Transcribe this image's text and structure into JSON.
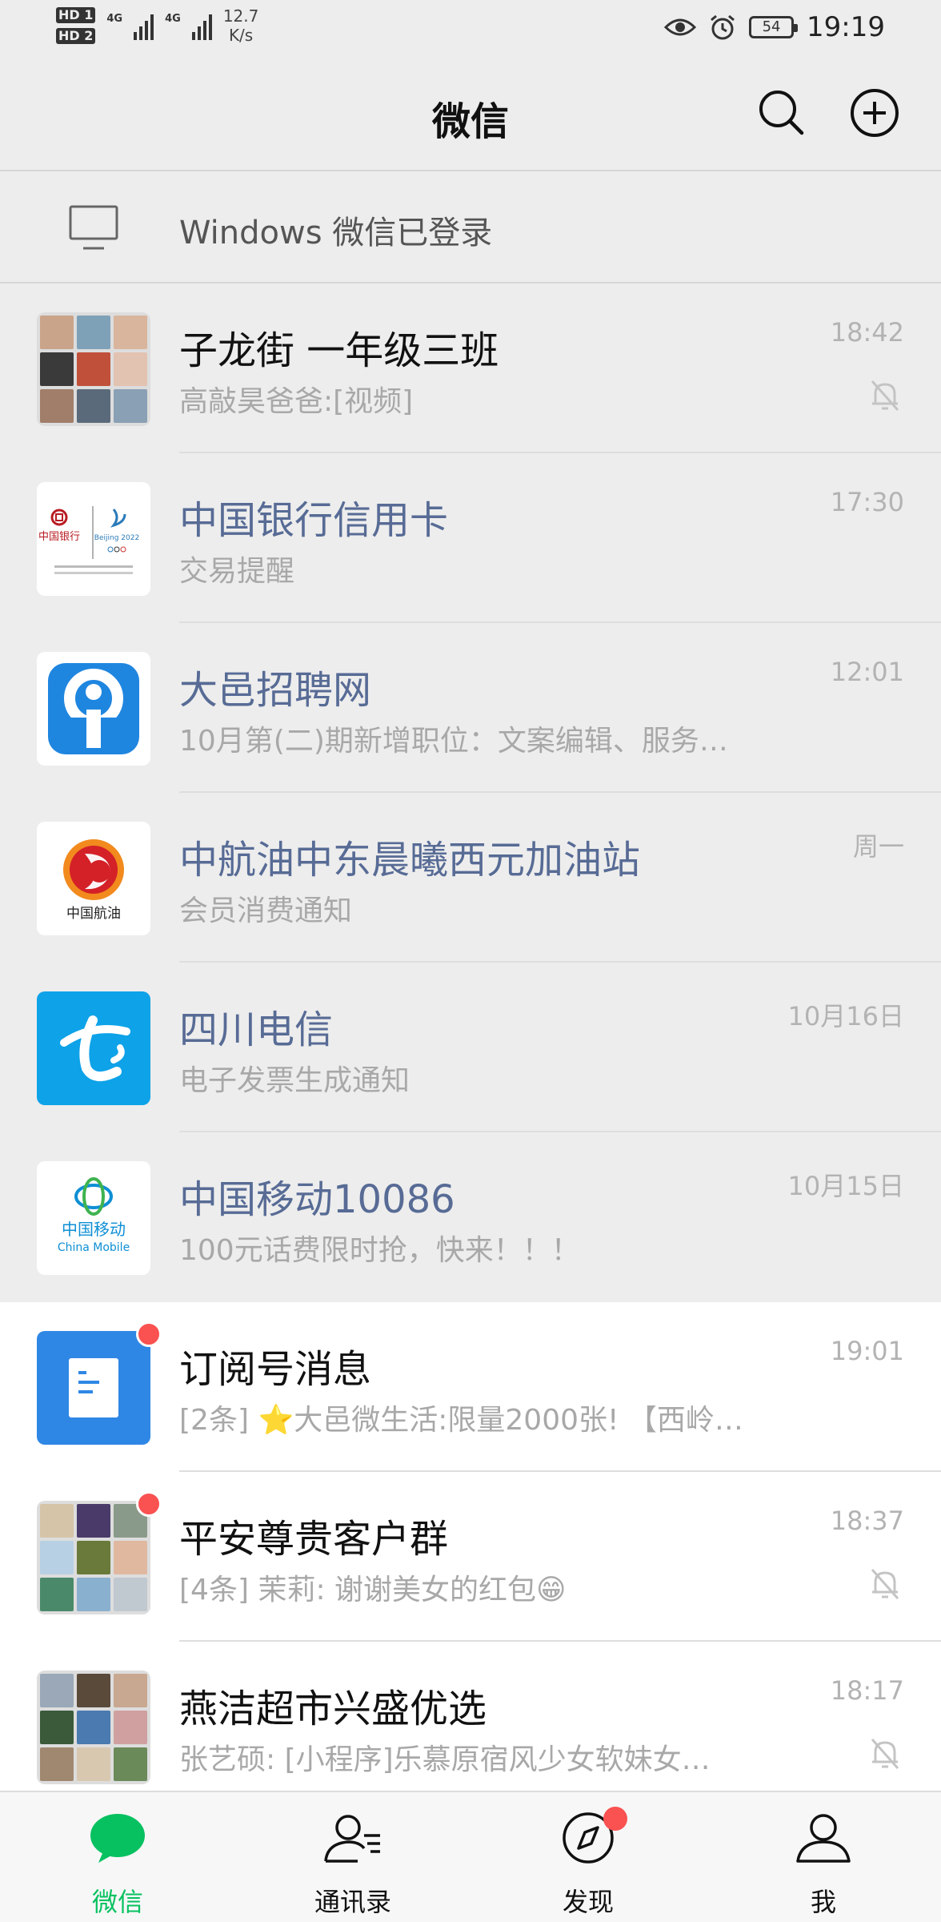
{
  "status_bar": {
    "sim1": "HD 1",
    "sim2": "HD 2",
    "net1": "4G",
    "net2": "4G",
    "speed_value": "12.7",
    "speed_unit": "K/s",
    "battery": "54",
    "time": "19:19"
  },
  "header": {
    "title": "微信",
    "search_icon": "search-icon",
    "add_icon": "plus-circle-icon"
  },
  "login_notice": {
    "icon": "monitor-icon",
    "text": "Windows 微信已登录"
  },
  "chats": [
    {
      "name": "子龙街 一年级三班",
      "preview": "高敲昊爸爸:[视频]",
      "time": "18:42",
      "muted": true,
      "unread_dot": false,
      "official": false,
      "pinned": true,
      "avatar": "group-avatar"
    },
    {
      "name": "中国银行信用卡",
      "preview": "交易提醒",
      "time": "17:30",
      "muted": false,
      "unread_dot": false,
      "official": true,
      "pinned": true,
      "avatar": "boc-logo"
    },
    {
      "name": "大邑招聘网",
      "preview": "10月第(二)期新增职位：文案编辑、服务…",
      "time": "12:01",
      "muted": false,
      "unread_dot": false,
      "official": true,
      "pinned": true,
      "avatar": "dayi-logo"
    },
    {
      "name": "中航油中东晨曦西元加油站",
      "preview": "会员消费通知",
      "time": "周一",
      "muted": false,
      "unread_dot": false,
      "official": true,
      "pinned": true,
      "avatar": "cnaf-logo"
    },
    {
      "name": "四川电信",
      "preview": "电子发票生成通知",
      "time": "10月16日",
      "muted": false,
      "unread_dot": false,
      "official": true,
      "pinned": true,
      "avatar": "telecom-logo"
    },
    {
      "name": "中国移动10086",
      "preview": "100元话费限时抢，快来！！！",
      "time": "10月15日",
      "muted": false,
      "unread_dot": false,
      "official": true,
      "pinned": true,
      "avatar": "china-mobile-logo"
    },
    {
      "name": "订阅号消息",
      "preview": "[2条] ⭐大邑微生活:限量2000张! 【西岭…",
      "time": "19:01",
      "muted": false,
      "unread_dot": true,
      "official": false,
      "pinned": false,
      "avatar": "subscription-icon"
    },
    {
      "name": "平安尊贵客户群",
      "preview": "[4条] 茉莉: 谢谢美女的红包😁",
      "time": "18:37",
      "muted": true,
      "unread_dot": true,
      "official": false,
      "pinned": false,
      "avatar": "group-avatar"
    },
    {
      "name": "燕洁超市兴盛优选",
      "preview": "张艺硕: [小程序]乐慕原宿风少女软妹女…",
      "time": "18:17",
      "muted": true,
      "unread_dot": false,
      "official": false,
      "pinned": false,
      "avatar": "group-avatar"
    }
  ],
  "avatar_text": {
    "boc": "中国银行",
    "boc_sub": "Beijing 2022",
    "cnaf": "中国航油",
    "cmcc_cn": "中国移动",
    "cmcc_en": "China Mobile"
  },
  "tabs": [
    {
      "label": "微信",
      "icon": "chat-bubble-icon",
      "active": true
    },
    {
      "label": "通讯录",
      "icon": "contacts-icon",
      "active": false
    },
    {
      "label": "发现",
      "icon": "compass-icon",
      "active": false,
      "badge_dot": true
    },
    {
      "label": "我",
      "icon": "person-icon",
      "active": false
    }
  ],
  "colors": {
    "accent": "#07c160",
    "official_name": "#576b95",
    "badge": "#fa5151",
    "background": "#ededed"
  }
}
